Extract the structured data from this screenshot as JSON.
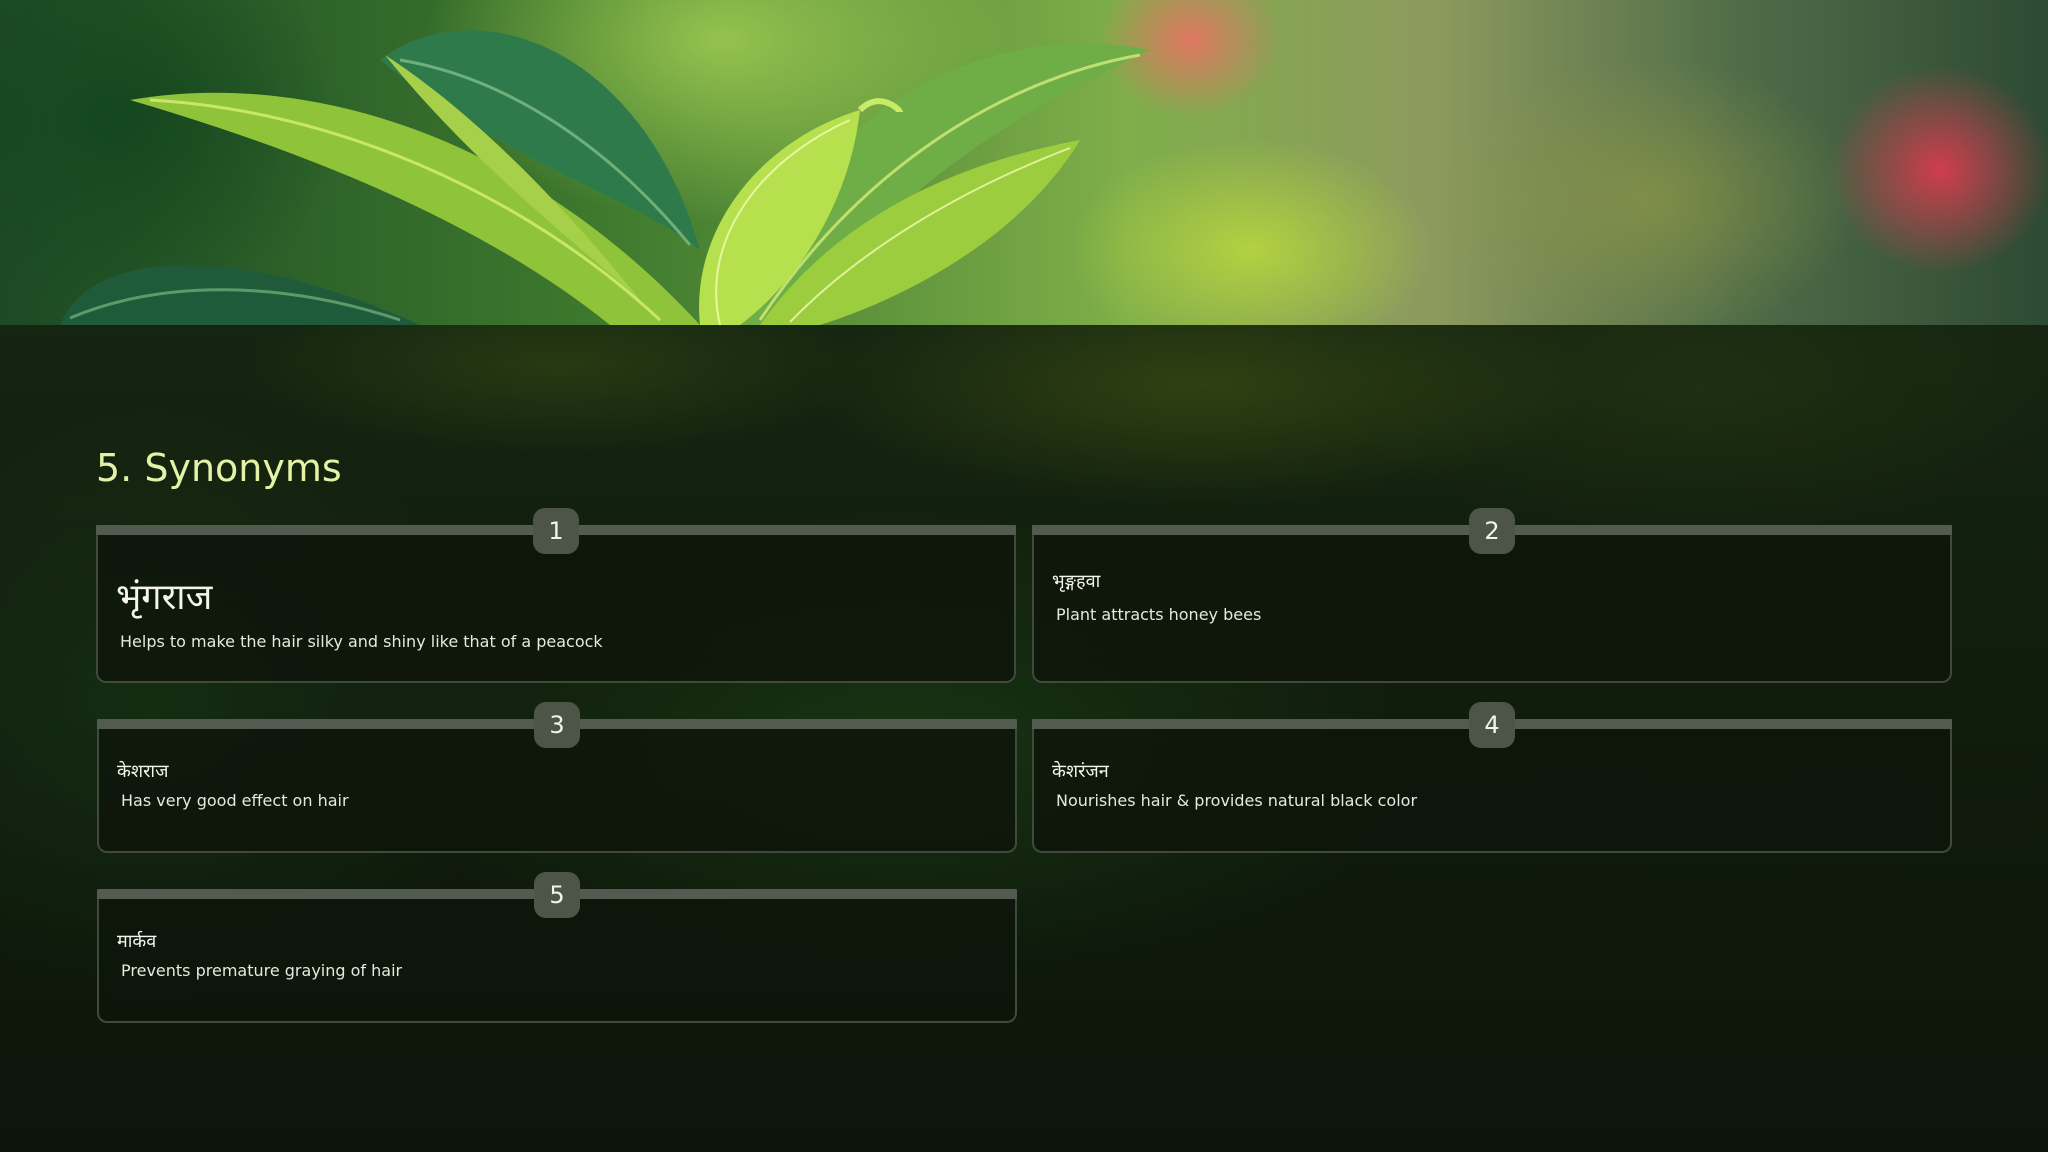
{
  "section": {
    "title": "5. Synonyms"
  },
  "synonyms": [
    {
      "number": "1",
      "term": "भृंगराज",
      "description": "Helps to make the hair silky and shiny like that of a peacock"
    },
    {
      "number": "2",
      "term": "भृङ्गहवा",
      "description": "Plant attracts honey bees"
    },
    {
      "number": "3",
      "term": "केशराज",
      "description": "Has very good effect on hair"
    },
    {
      "number": "4",
      "term": "केशरंजन",
      "description": "Nourishes hair & provides natural black color"
    },
    {
      "number": "5",
      "term": "मार्कव",
      "description": "Prevents premature graying of hair"
    }
  ],
  "images": {
    "hero": "green-leaves-photo-icon"
  },
  "colors": {
    "title": "#e3f2a4",
    "card_background": "#0e160a",
    "card_border": "#3f4a3a",
    "number_badge": "#4d5549",
    "text": "#e5e9df"
  }
}
